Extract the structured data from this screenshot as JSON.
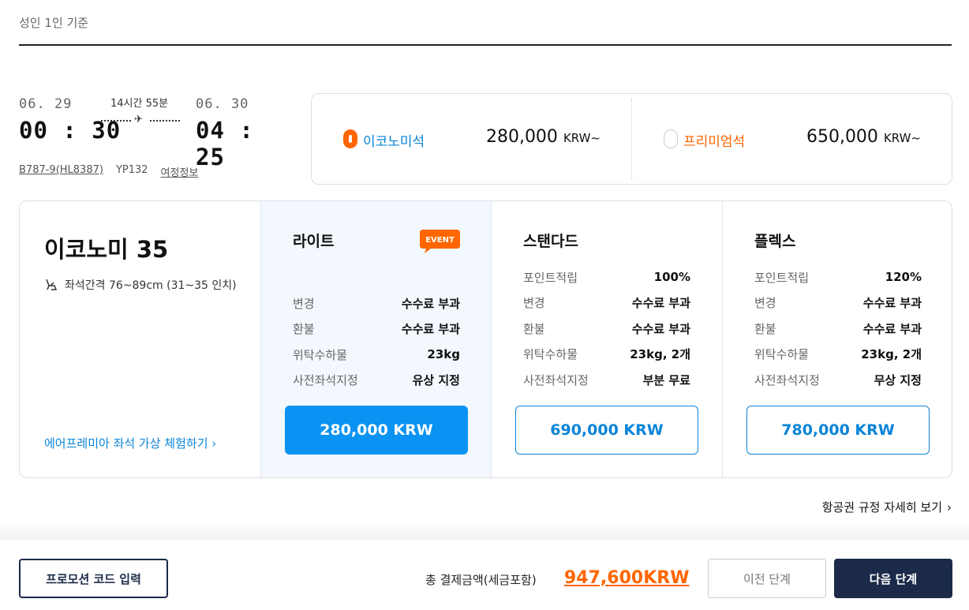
{
  "header": {
    "basis_label": "성인 1인 기준"
  },
  "flight": {
    "departure": {
      "date": "06. 29",
      "time": "00 : 30"
    },
    "arrival": {
      "date": "06. 30",
      "time": "04 : 25"
    },
    "duration": "14시간 55분",
    "aircraft": "B787-9(HL8387)",
    "flight_no": "YP132",
    "itinerary_link": "여정정보"
  },
  "cabins": [
    {
      "name": "이코노미석",
      "price": "280,000",
      "currency": "KRW~",
      "selected": true
    },
    {
      "name": "프리미엄석",
      "price": "650,000",
      "currency": "KRW~",
      "selected": false
    }
  ],
  "fare_intro": {
    "title": "이코노미 35",
    "seat_pitch": "좌석간격 76~89cm (31~35 인치)",
    "vr_link": "에어프레미아 좌석 가상 체험하기"
  },
  "fares": [
    {
      "name": "라이트",
      "badge": "EVENT",
      "rows": [
        {
          "k": "변경",
          "v": "수수료 부과"
        },
        {
          "k": "환불",
          "v": "수수료 부과"
        },
        {
          "k": "위탁수하물",
          "v": "23kg"
        },
        {
          "k": "사전좌석지정",
          "v": "유상 지정"
        }
      ],
      "price": "280,000 KRW"
    },
    {
      "name": "스탠다드",
      "rows": [
        {
          "k": "포인트적립",
          "v": "100%"
        },
        {
          "k": "변경",
          "v": "수수료 부과"
        },
        {
          "k": "환불",
          "v": "수수료 부과"
        },
        {
          "k": "위탁수하물",
          "v": "23kg, 2개"
        },
        {
          "k": "사전좌석지정",
          "v": "부분 무료"
        }
      ],
      "price": "690,000 KRW"
    },
    {
      "name": "플렉스",
      "rows": [
        {
          "k": "포인트적립",
          "v": "120%"
        },
        {
          "k": "변경",
          "v": "수수료 부과"
        },
        {
          "k": "환불",
          "v": "수수료 부과"
        },
        {
          "k": "위탁수하물",
          "v": "23kg, 2개"
        },
        {
          "k": "사전좌석지정",
          "v": "무상 지정"
        }
      ],
      "price": "780,000 KRW"
    }
  ],
  "rules_link": "항공권 규정 자세히 보기",
  "footer": {
    "promo_button": "프로모션 코드 입력",
    "total_label": "총 결제금액(세금포함)",
    "total_value": "947,600KRW",
    "prev_button": "이전 단계",
    "next_button": "다음 단계"
  },
  "colors": {
    "accent_orange": "#ff6600",
    "accent_blue": "#0a84d8",
    "navy": "#1b2a48"
  }
}
